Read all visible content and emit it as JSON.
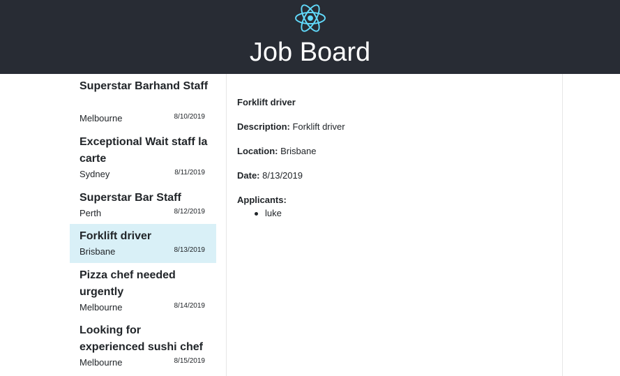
{
  "header": {
    "title": "Job Board",
    "logo_icon": "react-atom-icon",
    "logo_color": "#61dafb",
    "background": "#282c34"
  },
  "jobs": [
    {
      "title": "Superstar Barhand Staff",
      "location": "Melbourne",
      "date": "8/10/2019",
      "selected": false
    },
    {
      "title": "Exceptional Wait staff la carte",
      "location": "Sydney",
      "date": "8/11/2019",
      "selected": false
    },
    {
      "title": "Superstar Bar Staff",
      "location": "Perth",
      "date": "8/12/2019",
      "selected": false
    },
    {
      "title": "Forklift driver",
      "location": "Brisbane",
      "date": "8/13/2019",
      "selected": true
    },
    {
      "title": "Pizza chef needed urgently",
      "location": "Melbourne",
      "date": "8/14/2019",
      "selected": false
    },
    {
      "title": "Looking for experienced sushi chef",
      "location": "Melbourne",
      "date": "8/15/2019",
      "selected": false
    }
  ],
  "detail": {
    "title": "Forklift driver",
    "description_label": "Description:",
    "description": "Forklift driver",
    "location_label": "Location:",
    "location": "Brisbane",
    "date_label": "Date:",
    "date": "8/13/2019",
    "applicants_label": "Applicants:",
    "applicants": [
      "luke"
    ]
  }
}
